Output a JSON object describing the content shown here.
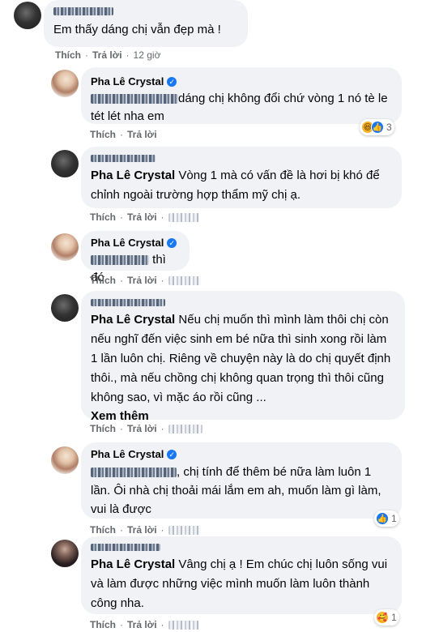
{
  "labels": {
    "like": "Thích",
    "reply": "Trả lời",
    "dot": "·",
    "see_more": "Xem thêm",
    "verified_mark": "✓"
  },
  "comments": [
    {
      "text": "Em thấy dáng chị vẫn đẹp mà !",
      "time": "12 giờ"
    },
    {
      "author": "Pha Lê Crystal",
      "text": "dáng chị không đổi chứ vòng 1 nó tè le tét lét nha em",
      "reactions": [
        "haha",
        "like"
      ],
      "reaction_count": "3"
    },
    {
      "author": "Pha Lê Crystal",
      "text": "Vòng 1 mà có vấn đề là hơi bị khó để chỉnh ngoài trường hợp thẩm mỹ chị ạ."
    },
    {
      "author": "Pha Lê Crystal",
      "text": "thì đó"
    },
    {
      "author": "Pha Lê Crystal",
      "text_line1": "Nếu chị muốn thì mình làm thôi chị",
      "text_rest": "còn nếu nghĩ đến việc sinh em bé nữa thì sinh xong rồi làm 1 lần luôn chị. Riêng về chuyện này là do chị quyết định thôi., mà nếu chồng chị không quan trọng thì thôi cũng không sao, vì mặc áo rồi cũng ..."
    },
    {
      "author": "Pha Lê Crystal",
      "text": ", chị tính để thêm bé nữa làm luôn 1 lần. Ôi nhà chị thoải mái lắm em ah, muốn làm gì làm, vui là được",
      "reactions": [
        "like"
      ],
      "reaction_count": "1"
    },
    {
      "author": "Pha Lê Crystal",
      "text_line1": "Vâng chị ạ ! Em chúc chị luôn sống",
      "text_rest": "vui và làm được những việc mình muốn làm luôn thành công nha.",
      "reactions": [
        "care"
      ],
      "reaction_count": "1"
    }
  ],
  "colors": {
    "bubble": "#f0f2f5",
    "meta_text": "#65676b",
    "verified": "#1877f2",
    "like": "#1877f2",
    "haha": "#f7b125"
  },
  "icons": [
    "verified-badge-icon",
    "like-reaction-icon",
    "haha-reaction-icon",
    "care-reaction-icon"
  ]
}
